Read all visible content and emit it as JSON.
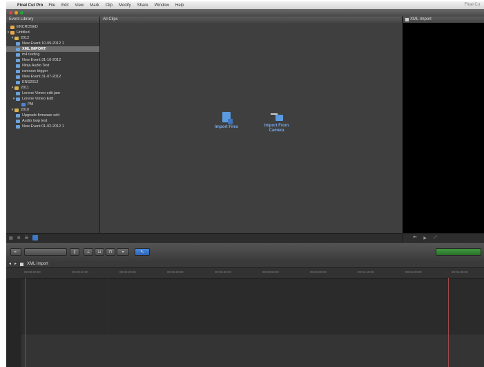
{
  "menubar": {
    "app_name": "Final Cut Pro",
    "items": [
      "File",
      "Edit",
      "View",
      "Mark",
      "Clip",
      "Modify",
      "Share",
      "Window",
      "Help"
    ],
    "right_text": "Final Cu"
  },
  "library": {
    "title": "Event Library",
    "items": [
      {
        "label": "ENCRDSED",
        "kind": "drive",
        "tri": ""
      },
      {
        "label": "Untitled",
        "kind": "drive",
        "tri": "▾"
      },
      {
        "label": "2012",
        "kind": "folder",
        "tri": "▾"
      },
      {
        "label": "New Event 10-09-2012 1",
        "kind": "event",
        "tri": ""
      },
      {
        "label": "XML IMPORT",
        "kind": "event",
        "tri": "",
        "selected": true
      },
      {
        "label": "m4 testing",
        "kind": "event",
        "tri": ""
      },
      {
        "label": "New Event 31-10-2012",
        "kind": "event",
        "tri": ""
      },
      {
        "label": "Ninja Audio Test",
        "kind": "event",
        "tri": ""
      },
      {
        "label": "ramrose trigger",
        "kind": "event",
        "tri": ""
      },
      {
        "label": "New Event 31-07-2012",
        "kind": "event",
        "tri": ""
      },
      {
        "label": "ENS2012",
        "kind": "event",
        "tri": ""
      },
      {
        "label": "2011",
        "kind": "folder",
        "tri": "▾"
      },
      {
        "label": "Lorene Vimeo edit jam",
        "kind": "event",
        "tri": ""
      },
      {
        "label": "Lorene Vimeo Edit",
        "kind": "event",
        "tri": "▾"
      },
      {
        "label": "PM",
        "kind": "clip",
        "tri": ""
      },
      {
        "label": "2010",
        "kind": "folder",
        "tri": "▾"
      },
      {
        "label": "Upgrade firmware edit",
        "kind": "event",
        "tri": ""
      },
      {
        "label": "Audio loop test",
        "kind": "event",
        "tri": ""
      },
      {
        "label": "New Event 01-02-2012 1",
        "kind": "event",
        "tri": ""
      }
    ]
  },
  "browser": {
    "title": "All Clips",
    "import_files": "Import Files",
    "import_camera_line1": "Import From",
    "import_camera_line2": "Camera"
  },
  "viewer": {
    "title": "XML Import"
  },
  "timeline": {
    "project_name": "XML Import",
    "ruler_ticks": [
      "00:00:00:00",
      "00:00:10:00",
      "00:00:20:00",
      "00:00:30:00",
      "00:00:40:00",
      "00:00:50:00",
      "00:01:00:00",
      "00:01:10:00",
      "00:01:20:00",
      "00:01:30:00"
    ]
  },
  "colors": {
    "accent_blue": "#3d79c6",
    "selection_gray": "#6e6e6e",
    "timeline_end_marker": "#a14a4a"
  }
}
